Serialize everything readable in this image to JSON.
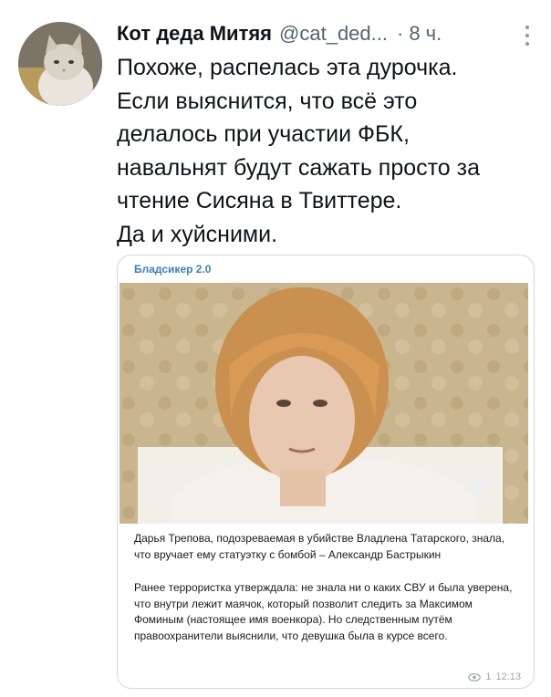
{
  "tweet": {
    "author_name": "Кот деда Митяя",
    "author_handle": "@cat_ded...",
    "time": "8 ч.",
    "text_lines": [
      "Похоже, распелась эта дурочка.",
      "Если выяснится, что всё это",
      "делалось при участии ФБК,",
      "навальнят будут сажать просто за",
      "чтение Сисяна в Твиттере.",
      "Да и хуйсними."
    ]
  },
  "embedded_post": {
    "channel": "Бладсикер 2.0",
    "photo_description_icon": "photo-of-woman",
    "headline": "Дарья Трепова, подозреваемая в убийстве Владлена Татарского, знала, что вручает ему статуэтку с бомбой – Александр Бастрыкин",
    "body": "Ранее террористка утверждала: не знала ни о каких СВУ и была уверена, что внутри лежит маячок, который позволит следить за Максимом Фоминым (настоящее имя военкора). Но следственным путём правоохранители выяснили, что девушка была в курсе всего.",
    "views": "1",
    "time": "12:13"
  },
  "colors": {
    "name": "#0f1419",
    "secondary": "#536471",
    "channel": "#3a7fc4",
    "card_border": "#cfd9de"
  }
}
